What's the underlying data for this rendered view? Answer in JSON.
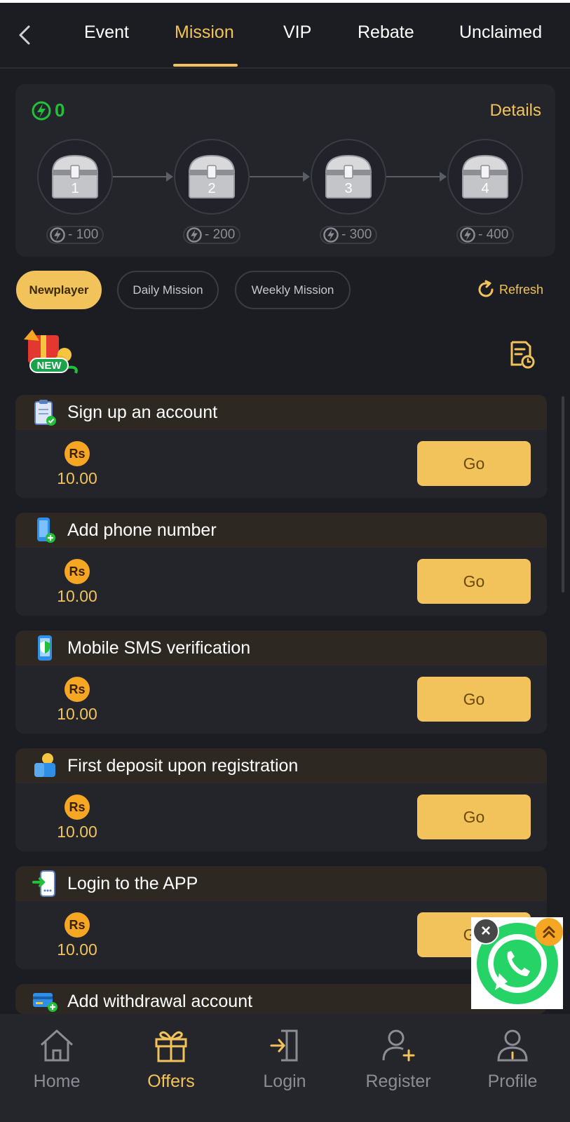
{
  "header": {
    "tabs": [
      {
        "label": "Event",
        "active": false
      },
      {
        "label": "Mission",
        "active": true
      },
      {
        "label": "VIP",
        "active": false
      },
      {
        "label": "Rebate",
        "active": false
      },
      {
        "label": "Unclaimed",
        "active": false
      }
    ],
    "back_icon": "chevron-left-icon"
  },
  "energy": {
    "count": "0",
    "details_label": "Details",
    "chests": [
      {
        "number": "1",
        "cost": "- 100"
      },
      {
        "number": "2",
        "cost": "- 200"
      },
      {
        "number": "3",
        "cost": "- 300"
      },
      {
        "number": "4",
        "cost": "- 400"
      }
    ]
  },
  "filters": {
    "chips": [
      {
        "label": "Newplayer",
        "active": true
      },
      {
        "label": "Daily Mission",
        "active": false
      },
      {
        "label": "Weekly Mission",
        "active": false
      }
    ],
    "refresh_label": "Refresh"
  },
  "badge": {
    "new_label": "NEW"
  },
  "missions": [
    {
      "title": "Sign up an account",
      "currency": "Rs",
      "amount": "10.00",
      "button": "Go",
      "icon": "clipboard-check-icon"
    },
    {
      "title": "Add phone number",
      "currency": "Rs",
      "amount": "10.00",
      "button": "Go",
      "icon": "phone-add-icon"
    },
    {
      "title": "Mobile SMS verification",
      "currency": "Rs",
      "amount": "10.00",
      "button": "Go",
      "icon": "phone-shield-icon"
    },
    {
      "title": "First deposit upon registration",
      "currency": "Rs",
      "amount": "10.00",
      "button": "Go",
      "icon": "wallet-coin-icon"
    },
    {
      "title": "Login to the APP",
      "currency": "Rs",
      "amount": "10.00",
      "button": "Go",
      "icon": "phone-login-icon"
    },
    {
      "title": "Add withdrawal account",
      "icon": "card-add-icon"
    }
  ],
  "bottom_nav": [
    {
      "label": "Home",
      "active": false,
      "icon": "home-icon"
    },
    {
      "label": "Offers",
      "active": true,
      "icon": "gift-icon"
    },
    {
      "label": "Login",
      "active": false,
      "icon": "login-icon"
    },
    {
      "label": "Register",
      "active": false,
      "icon": "user-add-icon"
    },
    {
      "label": "Profile",
      "active": false,
      "icon": "user-icon"
    }
  ],
  "colors": {
    "background": "#1c1d22",
    "panel": "#24252b",
    "accent": "#f2c35a",
    "energy_green": "#22c03a",
    "coin": "#f5a623",
    "whatsapp": "#25d366"
  }
}
